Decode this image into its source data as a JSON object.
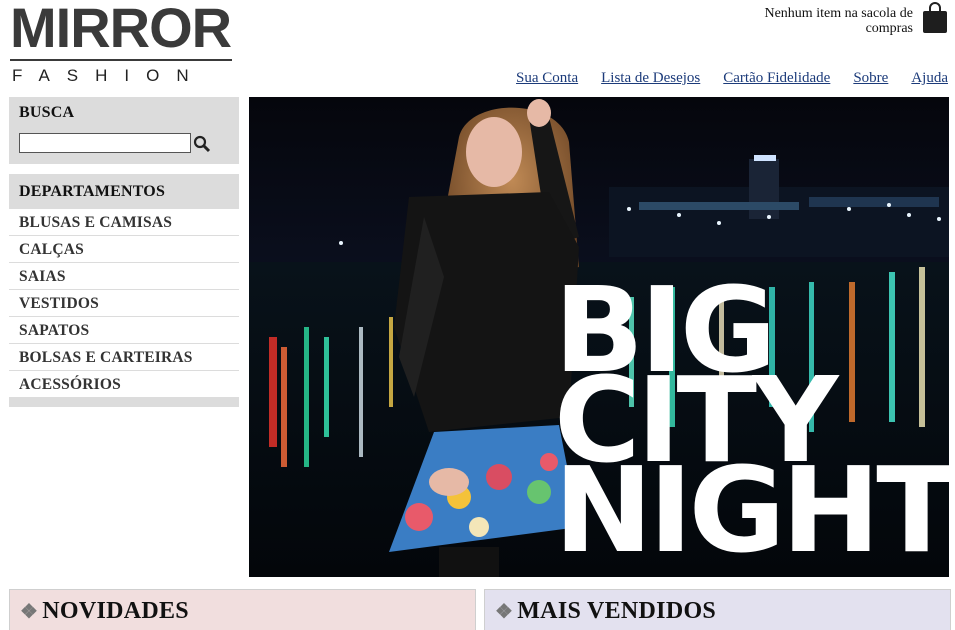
{
  "logo": {
    "main": "MIRROR",
    "sub": "FASHION"
  },
  "cart": {
    "text": "Nenhum item na sacola de compras"
  },
  "nav": {
    "items": [
      "Sua Conta",
      "Lista de Desejos",
      "Cartão Fidelidade",
      "Sobre",
      "Ajuda"
    ]
  },
  "search": {
    "title": "BUSCA",
    "value": "",
    "placeholder": ""
  },
  "departments": {
    "title": "DEPARTAMENTOS",
    "items": [
      "BLUSAS E CAMISAS",
      "CALÇAS",
      "SAIAS",
      "VESTIDOS",
      "SAPATOS",
      "BOLSAS E CARTEIRAS",
      "ACESSÓRIOS"
    ]
  },
  "hero": {
    "line1": "BIG",
    "line2": "CITY",
    "line3": "NIGHTS"
  },
  "sections": {
    "new": "NOVIDADES",
    "best": "MAIS VENDIDOS"
  },
  "colors": {
    "link": "#1c3b7a",
    "sidebar_bg": "#dcdcdc",
    "new_bg": "#f1dede",
    "best_bg": "#e3e1ef"
  },
  "icons": {
    "cart": "shopping-bag-icon",
    "search": "magnifier-icon",
    "bullet": "diamond-bullet-icon"
  }
}
